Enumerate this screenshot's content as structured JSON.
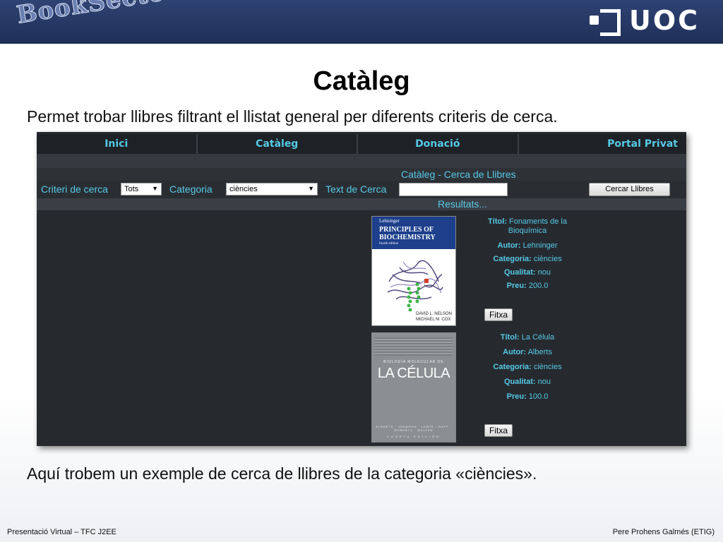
{
  "banner": {
    "brand": "BookSector",
    "logo_text": "UOC"
  },
  "slide": {
    "title": "Catàleg",
    "subtitle": "Permet trobar llibres filtrant el llistat general per diferents criteris de cerca.",
    "note": "Aquí trobem un exemple de cerca de llibres de la categoria «ciències».",
    "footer_left": "Presentació Virtual – TFC J2EE",
    "footer_right": "Pere Prohens Galmés (ETIG)"
  },
  "app": {
    "nav": [
      {
        "label": "Inici"
      },
      {
        "label": "Catàleg"
      },
      {
        "label": "Donació"
      },
      {
        "label": "Portal Privat"
      }
    ],
    "header": "Catàleg - Cerca de Llibres",
    "filters": {
      "criteri_label": "Criteri de cerca",
      "criteri_value": "Tots",
      "categoria_label": "Categoria",
      "categoria_value": "ciències",
      "text_label": "Text de Cerca",
      "text_value": "",
      "search_button": "Cercar Llibres"
    },
    "results_label": "Resultats...",
    "books": [
      {
        "cover": {
          "publisher": "Lehninger",
          "title_line1": "PRINCIPLES OF",
          "title_line2": "BIOCHEMISTRY",
          "edition": "fourth edition",
          "author1": "DAVID L. NELSON",
          "author2": "MICHAEL M. COX"
        },
        "title_key": "Títol:",
        "title_value": "Fonaments de la Bioquímica",
        "author_key": "Autor:",
        "author_value": "Lehninger",
        "category_key": "Categoria:",
        "category_value": "ciències",
        "quality_key": "Qualitat:",
        "quality_value": "nou",
        "price_key": "Preu:",
        "price_value": "200.0",
        "button": "Fitxa"
      },
      {
        "cover": {
          "small_text": "BIOLOGÍA MOLECULAR DE",
          "big_text": "LA CÉLULA",
          "authors": "ALBERTS · JOHNSON · LEWIS · RAFF · ROBERTS · WALTER",
          "edition": "CUARTA EDICIÓN"
        },
        "title_key": "Títol:",
        "title_value": "La Célula",
        "author_key": "Autor:",
        "author_value": "Alberts",
        "category_key": "Categoria:",
        "category_value": "ciències",
        "quality_key": "Qualitat:",
        "quality_value": "nou",
        "price_key": "Preu:",
        "price_value": "100.0",
        "button": "Fitxa"
      }
    ]
  }
}
